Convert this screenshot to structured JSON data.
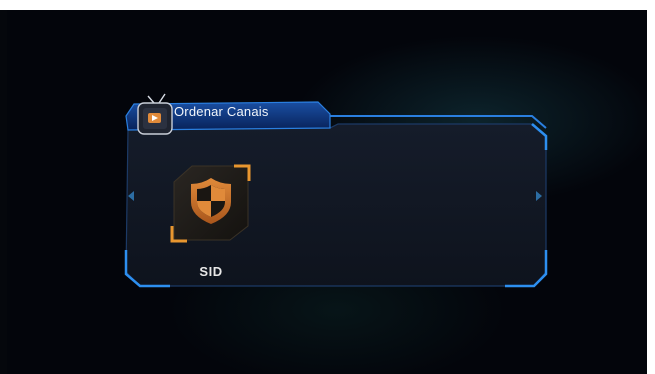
{
  "window": {
    "title": "Ordenar Canais"
  },
  "items": [
    {
      "label": "SID",
      "icon": "shield-icon",
      "selected": true
    }
  ],
  "colors": {
    "frame_accent": "#1f7fe0",
    "header_fill": "#0a2c6c",
    "panel_fill": "#121826",
    "selection": "#e8962f",
    "icon_orange": "#c8722a"
  }
}
